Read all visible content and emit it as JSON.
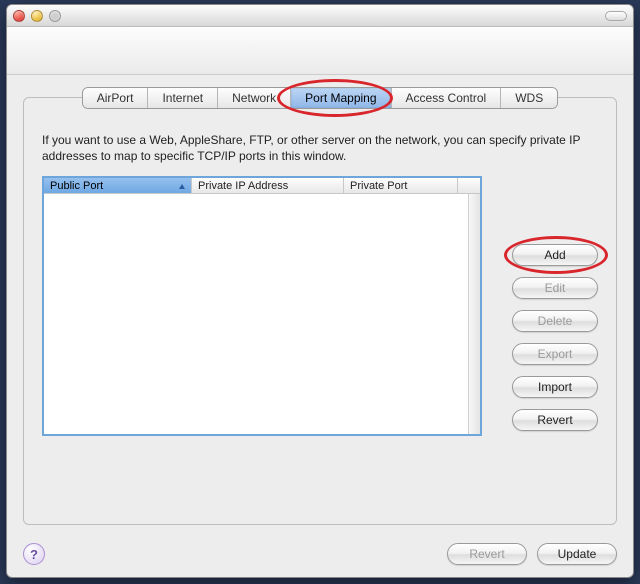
{
  "tabs": {
    "items": [
      "AirPort",
      "Internet",
      "Network",
      "Port Mapping",
      "Access Control",
      "WDS"
    ],
    "active_index": 3
  },
  "description": "If you want to use a Web, AppleShare, FTP, or other server on the network, you can specify private IP addresses to map to specific TCP/IP ports in this window.",
  "table": {
    "columns": [
      "Public Port",
      "Private IP Address",
      "Private Port"
    ],
    "sorted_column_index": 0,
    "rows": []
  },
  "side_buttons": [
    {
      "label": "Add",
      "enabled": true
    },
    {
      "label": "Edit",
      "enabled": false
    },
    {
      "label": "Delete",
      "enabled": false
    },
    {
      "label": "Export",
      "enabled": false
    },
    {
      "label": "Import",
      "enabled": true
    },
    {
      "label": "Revert",
      "enabled": true
    }
  ],
  "footer": {
    "help": "?",
    "revert": "Revert",
    "update": "Update",
    "revert_enabled": false,
    "update_enabled": true
  }
}
